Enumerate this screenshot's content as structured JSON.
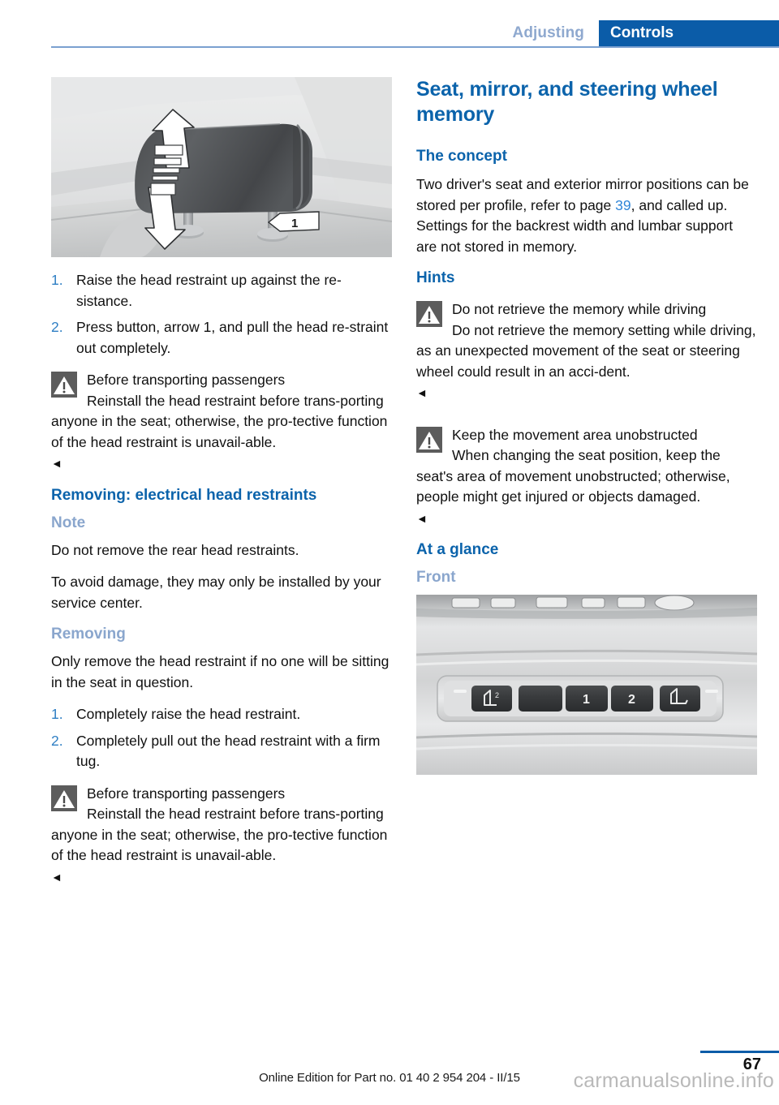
{
  "header": {
    "section": "Adjusting",
    "chapter": "Controls"
  },
  "left_column": {
    "figure_headrest": {
      "caption_alt": "head-restraint-illustration",
      "callout_number": "1"
    },
    "steps_1": [
      {
        "num": "1.",
        "text": "Raise the head restraint up against the re-sistance."
      },
      {
        "num": "2.",
        "text": "Press button, arrow 1, and pull the head re-straint out completely."
      }
    ],
    "warning_1": {
      "title": "Before transporting passengers",
      "text": "Reinstall the head restraint before trans-porting anyone in the seat; otherwise, the pro-tective function of the head restraint is unavail-able.",
      "endmark": "◄"
    },
    "heading_removing_electrical": "Removing: electrical head restraints",
    "heading_note": "Note",
    "note_paragraphs": [
      "Do not remove the rear head restraints.",
      "To avoid damage, they may only be installed by your service center."
    ],
    "heading_removing": "Removing",
    "removing_intro": "Only remove the head restraint if no one will be sitting in the seat in question.",
    "steps_2": [
      {
        "num": "1.",
        "text": "Completely raise the head restraint."
      },
      {
        "num": "2.",
        "text": "Completely pull out the head restraint with a firm tug."
      }
    ],
    "warning_2": {
      "title": "Before transporting passengers",
      "text": "Reinstall the head restraint before trans-porting anyone in the seat; otherwise, the pro-tective function of the head restraint is unavail-able.",
      "endmark": "◄"
    }
  },
  "right_column": {
    "title": "Seat, mirror, and steering wheel memory",
    "heading_concept": "The concept",
    "concept_text_before": "Two driver's seat and exterior mirror positions can be stored per profile, refer to page ",
    "concept_page_ref": "39",
    "concept_text_after": ", and called up. Settings for the backrest width and lumbar support are not stored in memory.",
    "heading_hints": "Hints",
    "warning_driving": {
      "title": "Do not retrieve the memory while driving",
      "text": "Do not retrieve the memory setting while driving, as an unexpected movement of the seat or steering wheel could result in an acci-dent.",
      "endmark": "◄"
    },
    "warning_movement": {
      "title": "Keep the movement area unobstructed",
      "text": "When changing the seat position, keep the seat's area of movement unobstructed; otherwise, people might get injured or objects damaged.",
      "endmark": "◄"
    },
    "heading_at_a_glance": "At a glance",
    "heading_front": "Front",
    "figure_memory": {
      "caption_alt": "memory-button-panel-illustration",
      "buttons": [
        "backrest-memory-icon",
        "set-button",
        "1",
        "2",
        "seat-memory-icon"
      ]
    }
  },
  "footer": {
    "edition": "Online Edition for Part no. 01 40 2 954 204 - II/15",
    "watermark": "carmanualsonline.info",
    "page_number": "67"
  },
  "colors": {
    "accent_blue": "#0b5ca8",
    "heading_blue": "#0b63ab",
    "subheading_blue": "#8aa6cd",
    "link_blue": "#2f85d8",
    "warning_box": "#5c5c5c"
  }
}
